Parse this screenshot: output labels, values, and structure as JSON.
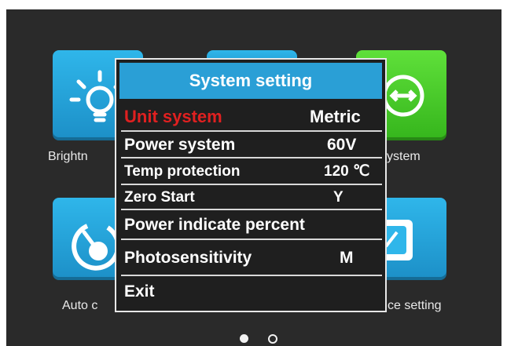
{
  "background_tiles": {
    "brightness": {
      "label": "Brightn",
      "icon": "lightbulb-icon",
      "color": "#2fb6ea"
    },
    "system": {
      "label": "ystem",
      "icon": "link-circle-icon",
      "color": "#5fe03a"
    },
    "auto": {
      "label": "Auto c",
      "icon": "gauge-off-icon",
      "color": "#2fb6ea"
    },
    "device_setting": {
      "label": "ce setting",
      "icon": "speedometer-icon",
      "color": "#2fb6ea"
    }
  },
  "pager": {
    "pages": 2,
    "current": 1
  },
  "dialog": {
    "title": "System setting",
    "rows": [
      {
        "label": "Unit system",
        "value": "Metric"
      },
      {
        "label": "Power system",
        "value": "60V"
      },
      {
        "label": "Temp protection",
        "value": "120 ℃"
      },
      {
        "label": "Zero Start",
        "value": "Y"
      },
      {
        "label": "Power indicate percent",
        "value": ""
      },
      {
        "label": "Photosensitivity",
        "value": "M"
      },
      {
        "label": "Exit",
        "value": ""
      }
    ],
    "highlight_color": "#e02020",
    "title_bar_color": "#2a9fd6"
  }
}
